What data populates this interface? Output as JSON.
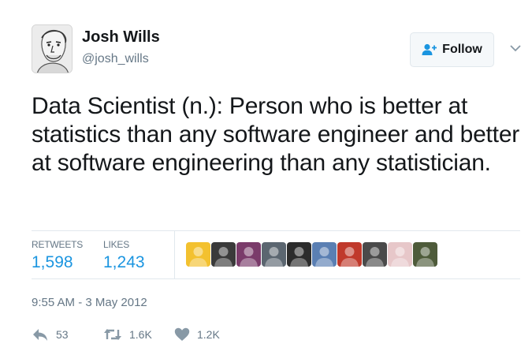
{
  "user": {
    "name": "Josh Wills",
    "handle": "@josh_wills",
    "avatar_icon": "caricature-avatar"
  },
  "follow_button": {
    "label": "Follow",
    "icon": "add-user-icon"
  },
  "menu_icon": "chevron-down-icon",
  "tweet": {
    "text": "Data Scientist (n.): Person who is better at statistics than any software engineer and better at software engineering than any statistician."
  },
  "stats": {
    "retweets_label": "RETWEETS",
    "retweets_value": "1,598",
    "likes_label": "LIKES",
    "likes_value": "1,243"
  },
  "likers": [
    {
      "icon": "liker-avatar",
      "color": "#f3c12f"
    },
    {
      "icon": "liker-avatar",
      "color": "#3a3a3a"
    },
    {
      "icon": "liker-avatar",
      "color": "#7a3b6a"
    },
    {
      "icon": "liker-avatar",
      "color": "#5b6670"
    },
    {
      "icon": "liker-avatar",
      "color": "#2c2c2c"
    },
    {
      "icon": "liker-avatar",
      "color": "#5a7fb3"
    },
    {
      "icon": "liker-avatar",
      "color": "#c0392b"
    },
    {
      "icon": "liker-avatar",
      "color": "#4a4a4a"
    },
    {
      "icon": "liker-avatar",
      "color": "#e7c7c9"
    },
    {
      "icon": "liker-avatar",
      "color": "#4e5b3a"
    }
  ],
  "timestamp": "9:55 AM - 3 May 2012",
  "actions": {
    "reply_count": "53",
    "retweet_count": "1.6K",
    "like_count": "1.2K"
  },
  "colors": {
    "accent": "#1b95e0",
    "text": "#14171a",
    "muted": "#657786",
    "divider": "#e1e8ed"
  }
}
